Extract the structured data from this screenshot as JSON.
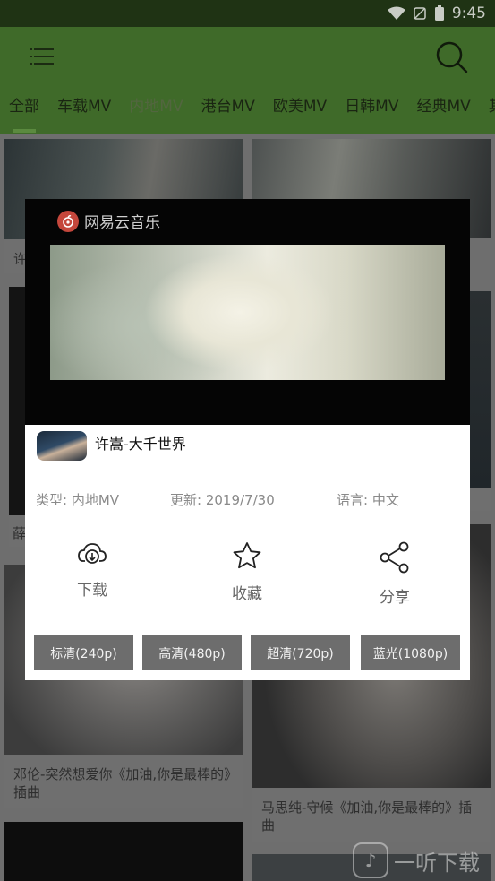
{
  "status_bar": {
    "time": "9:45",
    "icons": [
      "wifi-icon",
      "no-signal-icon",
      "battery-icon"
    ]
  },
  "app_bar": {
    "menu_icon": "menu-icon",
    "search_icon": "search-icon",
    "tabs": [
      {
        "label": "全部"
      },
      {
        "label": "车载MV"
      },
      {
        "label": "内地MV"
      },
      {
        "label": "港台MV"
      },
      {
        "label": "欧美MV"
      },
      {
        "label": "日韩MV"
      },
      {
        "label": "经典MV"
      },
      {
        "label": "其"
      }
    ],
    "active_tab": "内地MV"
  },
  "background_cards": [
    {
      "caption": "许"
    },
    {
      "caption": ""
    },
    {
      "caption": "薛"
    },
    {
      "caption": ""
    },
    {
      "caption": "邓伦-突然想爱你《加油,你是最棒的》插曲"
    },
    {
      "caption": "马思纯-守候《加油,你是最棒的》插曲"
    },
    {
      "caption": ""
    },
    {
      "caption": ""
    }
  ],
  "player": {
    "brand": "网易云音乐"
  },
  "dialog": {
    "title": "许嵩-大千世界",
    "meta": {
      "type": "类型: 内地MV",
      "updated": "更新: 2019/7/30",
      "language": "语言: 中文"
    },
    "actions": [
      {
        "label": "下载",
        "icon": "download-cloud-icon"
      },
      {
        "label": "收藏",
        "icon": "star-icon"
      },
      {
        "label": "分享",
        "icon": "share-icon"
      }
    ],
    "qualities": [
      {
        "label": "标清(240p)"
      },
      {
        "label": "高清(480p)"
      },
      {
        "label": "超清(720p)"
      },
      {
        "label": "蓝光(1080p)"
      }
    ]
  },
  "watermark": {
    "text": "一听下载"
  },
  "colors": {
    "app_bar": "#3f6a29",
    "status_bar": "#1f3314",
    "quality_button": "#6d6d6d",
    "dialog_bg": "#ffffff"
  }
}
